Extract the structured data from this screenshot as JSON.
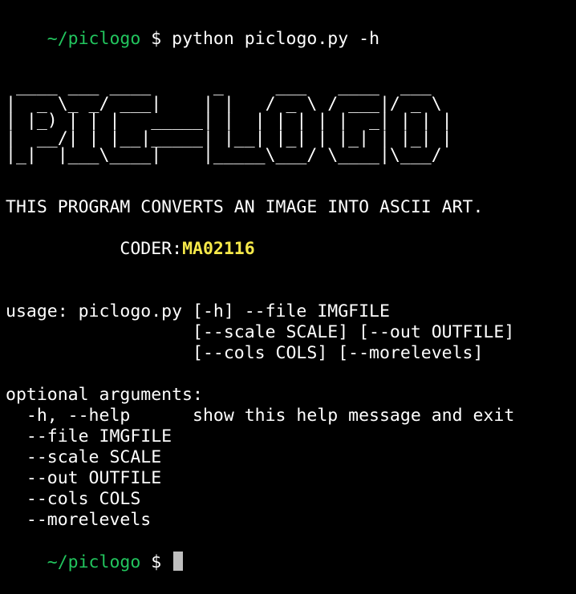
{
  "prompt": {
    "path": "~/piclogo",
    "symbol": "$"
  },
  "command": "python piclogo.py -h",
  "ascii_art": [
    " ____ ___ ____      _     ___   ____  ___  ",
    "|  _ \\_ _/ ___|    | |   / _ \\ / ___|/ _ \\ ",
    "| |_) | | |   _____| |  | | | | |  _| | | |",
    "|  __/| | |__|_____| |__| |_| | |_| | |_| |",
    "|_|  |___\\____|    |_____\\___/ \\____|\\___/ "
  ],
  "description": "THIS PROGRAM CONVERTS AN IMAGE INTO ASCII ART.",
  "coder": {
    "label": "CODER:",
    "name": "MA02116"
  },
  "usage": [
    "usage: piclogo.py [-h] --file IMGFILE",
    "                  [--scale SCALE] [--out OUTFILE]",
    "                  [--cols COLS] [--morelevels]"
  ],
  "optional_header": "optional arguments:",
  "arguments": [
    "  -h, --help      show this help message and exit",
    "  --file IMGFILE",
    "  --scale SCALE",
    "  --out OUTFILE",
    "  --cols COLS",
    "  --morelevels"
  ],
  "colors": {
    "background": "#000000",
    "prompt_path": "#22c55e",
    "coder_name": "#f6e94a",
    "text": "#ffffff",
    "cursor": "#bfbfbf"
  }
}
